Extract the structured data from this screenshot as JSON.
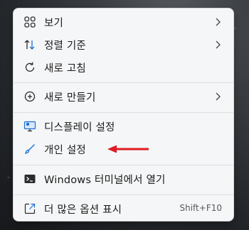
{
  "menu": {
    "items": [
      {
        "label": "보기",
        "icon": "view-grid-icon",
        "submenu": true
      },
      {
        "label": "정렬 기준",
        "icon": "sort-arrows-icon",
        "submenu": true
      },
      {
        "label": "새로 고침",
        "icon": "refresh-icon",
        "submenu": false
      },
      {
        "label": "새로 만들기",
        "icon": "new-plus-icon",
        "submenu": true
      },
      {
        "label": "디스플레이 설정",
        "icon": "display-icon",
        "submenu": false
      },
      {
        "label": "개인 설정",
        "icon": "brush-icon",
        "submenu": false
      },
      {
        "label": "Windows 터미널에서 열기",
        "icon": "terminal-icon",
        "submenu": false
      },
      {
        "label": "더 많은 옵션 표시",
        "icon": "more-options-icon",
        "submenu": false,
        "shortcut": "Shift+F10"
      }
    ]
  },
  "colors": {
    "menu_background": "#f5f6f7",
    "text": "#1b1b1b",
    "accent_blue": "#1c6fd1",
    "annotation_red": "#e01b24"
  }
}
